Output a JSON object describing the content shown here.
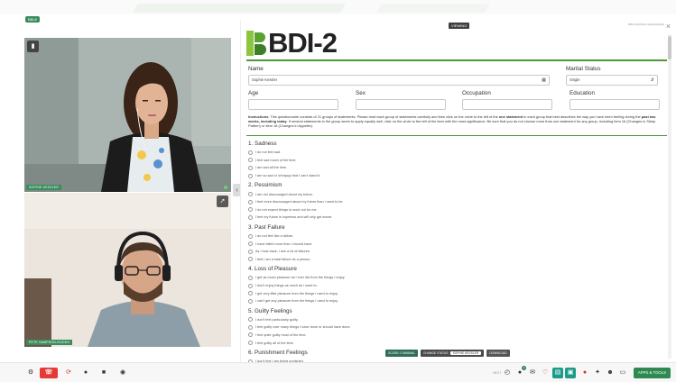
{
  "session_tag": "BBLE",
  "videos": [
    {
      "name_tag": "SOPHIE KESSLER",
      "top_button_icon": "speaker-icon"
    },
    {
      "name_tag": "PETE SAMPSON-RODEN",
      "top_button_icon": "expand-icon"
    }
  ],
  "form": {
    "viewing_badge": "VIEWING",
    "doc_id": "RBkzoZq5o0kzUHqdGMk8eQ",
    "logo_text": "BDI-2",
    "fields": {
      "name_label": "Name",
      "name_value": "Sophie Kessler",
      "marital_label": "Marital Status",
      "marital_value": "Single",
      "age_label": "Age",
      "sex_label": "Sex",
      "occupation_label": "Occupation",
      "education_label": "Education"
    },
    "instructions": {
      "lead": "Instructions.",
      "p1": " This questionnaire consists of 21 groups of statements. Please read each group of statements carefully and then click on the circle to the left of the ",
      "b1": "one statement",
      "p2": " in each group that best describes the way you have been feeling during the ",
      "b2": "past two weeks, including today",
      "p3": ". If several statements in the group seem to apply equally well, click on the circle to the left of the item with the most significance. Be sure that you do not choose more than one statement for any group, including Item 16 (Changes in Sleep Pattern) or Item 18 (Changes in Appetite)."
    },
    "questions": [
      {
        "title": "1. Sadness",
        "options": [
          "I do not feel sad.",
          "I feel sad much of the time.",
          "I am sad all the time.",
          "I am so sad or unhappy that I can't stand it."
        ]
      },
      {
        "title": "2. Pessimism",
        "options": [
          "I am not discouraged about my future.",
          "I feel more discouraged about my future than I used to be.",
          "I do not expect things to work out for me.",
          "I feel my future is hopeless and will only get worse."
        ]
      },
      {
        "title": "3. Past Failure",
        "options": [
          "I do not feel like a failure.",
          "I have failed more than I should have.",
          "As I look back, I see a lot of failures.",
          "I feel I am a total failure as a person."
        ]
      },
      {
        "title": "4. Loss of Pleasure",
        "options": [
          "I get as much pleasure as I ever did from the things I enjoy.",
          "I don't enjoy things as much as I used to.",
          "I get very little pleasure from the things I used to enjoy.",
          "I can't get any pleasure from the things I used to enjoy."
        ]
      },
      {
        "title": "5. Guilty Feelings",
        "options": [
          "I don't feel particularly guilty.",
          "I feel guilty over many things I have done or should have done.",
          "I feel quite guilty most of the time.",
          "I feel guilty all of the time."
        ]
      },
      {
        "title": "6. Punishment Feelings",
        "options": [
          "I don't feel I am being punished."
        ]
      }
    ],
    "actions": {
      "score_label": "SCORE: 0 MINIMAL",
      "status_label": "CHANGE STATUS",
      "status_value": "SOPHIE KESSLER",
      "download_label": "DOWNLOAD"
    }
  },
  "toolbar": {
    "next_label": "NEXT",
    "badge_count": "1",
    "apps_label": "APPS & TOOLS",
    "brand_color": "#2f8a52",
    "end_color": "#e53935"
  }
}
